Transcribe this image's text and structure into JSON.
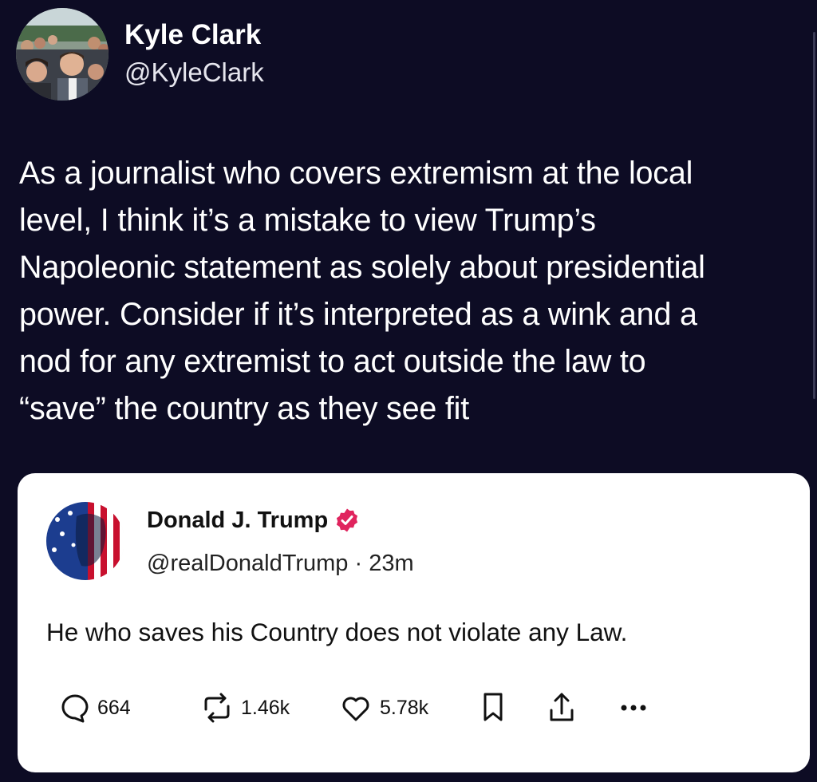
{
  "tweet": {
    "author": {
      "name": "Kyle Clark",
      "handle": "@KyleClark"
    },
    "text_lines": [
      "As a journalist who covers extremism at the local",
      "level, I think it’s a mistake to view Trump’s",
      "Napoleonic statement as solely about presidential",
      "power. Consider if it’s interpreted as a wink and a",
      "nod for any extremist to act outside the law to",
      "“save” the country as they see fit"
    ]
  },
  "quoted_post": {
    "author": {
      "name": "Donald J. Trump",
      "handle": "@realDonaldTrump",
      "separator": "·",
      "time": "23m",
      "verified": true
    },
    "text": "He who saves his Country does not violate any Law.",
    "actions": {
      "replies": "664",
      "reposts": "1.46k",
      "likes": "5.78k"
    }
  },
  "icons": {
    "reply": "reply-icon",
    "repost": "repost-icon",
    "like": "heart-icon",
    "bookmark": "bookmark-icon",
    "share": "share-icon",
    "more": "more-icon",
    "verified": "verified-badge-icon"
  },
  "colors": {
    "background": "#0d0c24",
    "card": "#ffffff",
    "verified_badge": "#e0245e"
  }
}
